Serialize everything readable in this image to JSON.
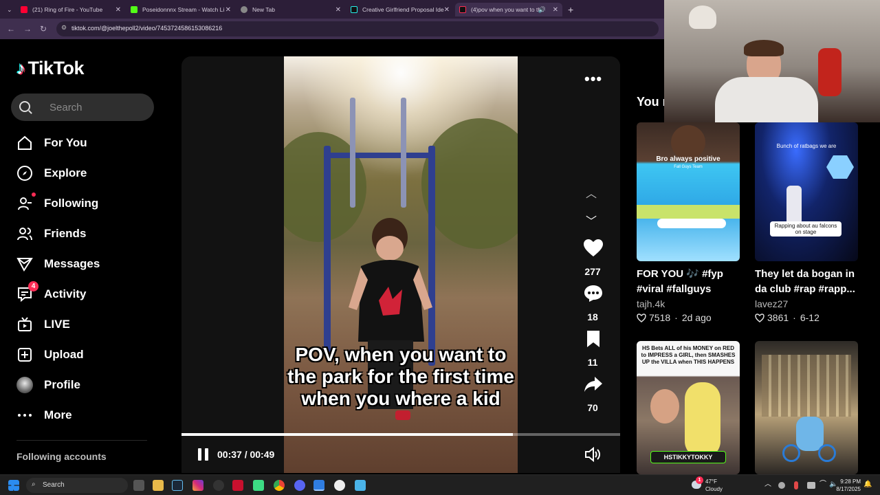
{
  "browser": {
    "tabs": [
      {
        "label": "(21) Ring of Fire - YouTube",
        "color": "#ff0033"
      },
      {
        "label": "Poseidonnnx Stream - Watch Li",
        "color": "#53fc18"
      },
      {
        "label": "New Tab",
        "color": "#888888"
      },
      {
        "label": "Creative Girlfriend Proposal Ide",
        "color": "#222222"
      },
      {
        "label": "(4)pov when you want to th",
        "color": "#222222"
      }
    ],
    "new_tab_glyph": "+",
    "url": "tiktok.com/@joelthepoll2/video/7453724586153086216"
  },
  "sidebar": {
    "logo_text": "TikTok",
    "search_placeholder": "Search",
    "items": [
      {
        "label": "For You"
      },
      {
        "label": "Explore"
      },
      {
        "label": "Following"
      },
      {
        "label": "Friends"
      },
      {
        "label": "Messages"
      },
      {
        "label": "Activity",
        "badge": "4"
      },
      {
        "label": "LIVE"
      },
      {
        "label": "Upload"
      },
      {
        "label": "Profile"
      },
      {
        "label": "More"
      }
    ],
    "following_accounts_label": "Following accounts"
  },
  "video": {
    "caption": "POV, when you want to the park for the first time when you where a kid",
    "time": "00:37 / 00:49",
    "progress_fraction": 0.755,
    "likes": "277",
    "comments": "18",
    "saves": "11",
    "shares": "70"
  },
  "recommendations": {
    "title": "You m",
    "cards": [
      {
        "title": "FOR YOU 🎶 #fyp #viral #fallguys",
        "author": "tajh.4k",
        "likes": "7518",
        "date": "2d ago",
        "overlay": "Bro always positive",
        "overlay2": "Fall Guys Team"
      },
      {
        "title": "They let da bogan in da club #rap #rapp...",
        "author": "lavez27",
        "likes": "3861",
        "date": "6-12",
        "overlay": "Bunch of ratbags we are",
        "overlay2": "Rapping about au falcons on stage"
      },
      {
        "title": "",
        "author": "",
        "likes": "",
        "date": "",
        "overlay": "HS Bets ALL of his MONEY on RED to IMPRESS a GIRL, then SMASHES UP the VILLA when THIS HAPPENS",
        "overlay2": "HSTIKKYTOKKY"
      },
      {
        "title": "",
        "author": "",
        "likes": "",
        "date": "",
        "overlay": "",
        "overlay2": ""
      }
    ]
  },
  "taskbar": {
    "search_label": "Search",
    "weather_temp": "47°F",
    "weather_desc": "Cloudy",
    "weather_badge": "1",
    "time": "9:28 PM",
    "date": "8/17/2025"
  },
  "colors": {
    "accent": "#fe2c55",
    "cyan": "#25f4ee"
  }
}
